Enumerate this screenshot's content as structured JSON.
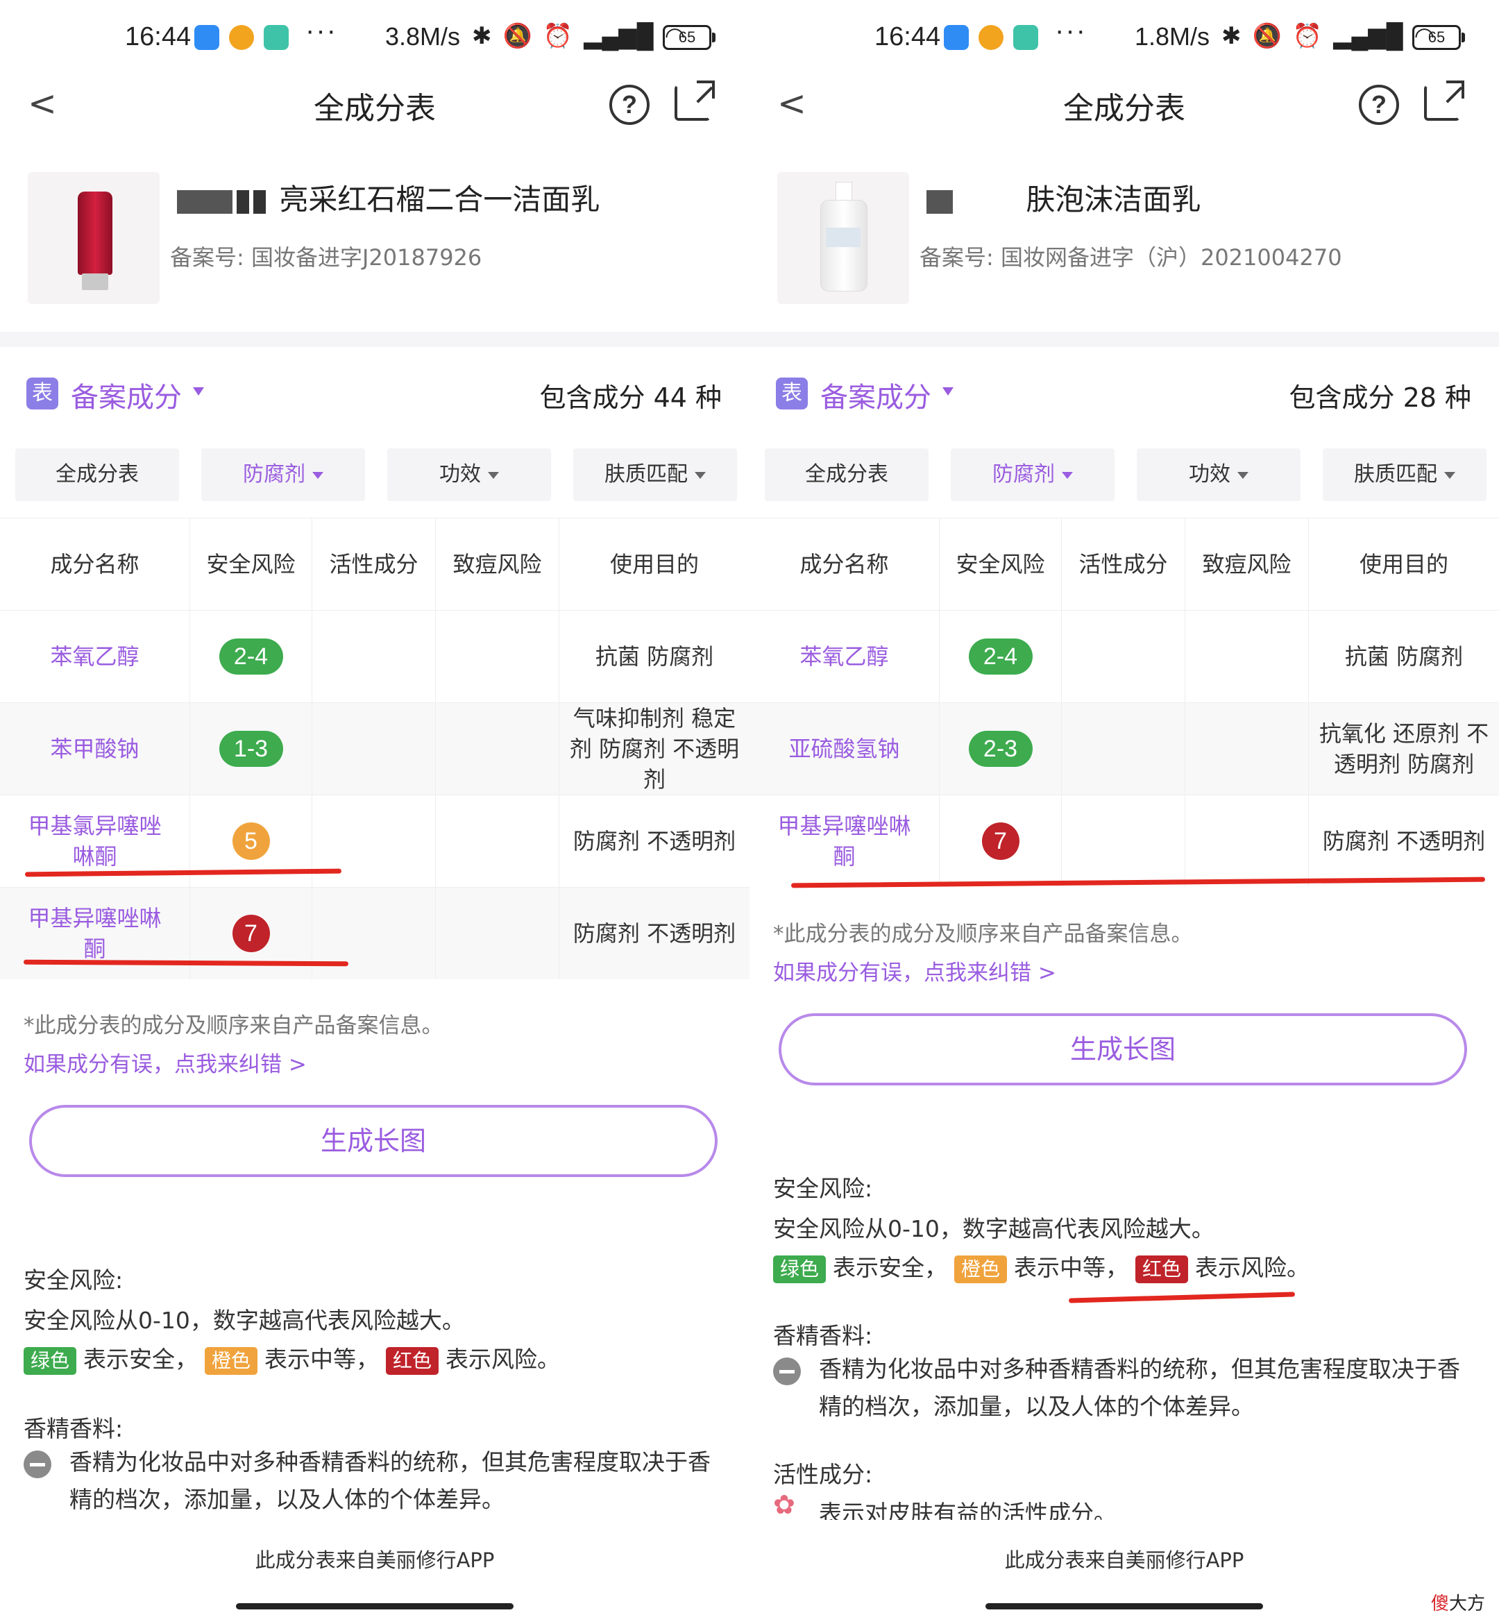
{
  "left": {
    "status": {
      "time": "16:44",
      "dots": "···",
      "speed": "3.8M/s",
      "battery": "65"
    },
    "header": {
      "back": "<",
      "title": "全成分表",
      "help": "?"
    },
    "product": {
      "name": "亮采红石榴二合一洁面乳",
      "reg": "备案号: 国妆备进字J20187926"
    },
    "section": {
      "badge": "表",
      "label": "备案成分",
      "count": "包含成分 44 种"
    },
    "tabs": [
      "全成分表",
      "防腐剂",
      "功效",
      "肤质匹配"
    ],
    "headers": [
      "成分名称",
      "安全风险",
      "活性成分",
      "致痘风险",
      "使用目的"
    ],
    "rows": [
      {
        "name": "苯氧乙醇",
        "risk": "2-4",
        "purpose": "抗菌 防腐剂"
      },
      {
        "name": "苯甲酸钠",
        "risk": "1-3",
        "purpose": "气味抑制剂 稳定剂 防腐剂 不透明剂"
      },
      {
        "name": "甲基氯异噻唑啉酮",
        "risk": "5",
        "purpose": "防腐剂 不透明剂"
      },
      {
        "name": "甲基异噻唑啉酮",
        "risk": "7",
        "purpose": "防腐剂 不透明剂"
      }
    ],
    "note": "*此成分表的成分及顺序来自产品备案信息。",
    "fix": "如果成分有误，点我来纠错 >",
    "button": "生成长图",
    "safety_title": "安全风险:",
    "safety_text": "安全风险从0-10，数字越高代表风险越大。",
    "legend": {
      "green": "绿色",
      "green_text": "表示安全，",
      "orange": "橙色",
      "orange_text": "表示中等，",
      "red": "红色",
      "red_text": "表示风险。"
    },
    "fragrance_title": "香精香料:",
    "fragrance_text": "香精为化妆品中对多种香精香料的统称，但其危害程度取决于香精的档次，添加量，以及人体的个体差异。",
    "footer": "此成分表来自美丽修行APP"
  },
  "right": {
    "status": {
      "time": "16:44",
      "dots": "···",
      "speed": "1.8M/s",
      "battery": "65"
    },
    "header": {
      "back": "<",
      "title": "全成分表",
      "help": "?"
    },
    "product": {
      "name": "肤泡沫洁面乳",
      "reg": "备案号: 国妆网备进字（沪）2021004270"
    },
    "section": {
      "badge": "表",
      "label": "备案成分",
      "count": "包含成分 28 种"
    },
    "tabs": [
      "全成分表",
      "防腐剂",
      "功效",
      "肤质匹配"
    ],
    "headers": [
      "成分名称",
      "安全风险",
      "活性成分",
      "致痘风险",
      "使用目的"
    ],
    "rows": [
      {
        "name": "苯氧乙醇",
        "risk": "2-4",
        "purpose": "抗菌 防腐剂"
      },
      {
        "name": "亚硫酸氢钠",
        "risk": "2-3",
        "purpose": "抗氧化 还原剂 不透明剂 防腐剂"
      },
      {
        "name": "甲基异噻唑啉酮",
        "risk": "7",
        "purpose": "防腐剂 不透明剂"
      }
    ],
    "note": "*此成分表的成分及顺序来自产品备案信息。",
    "fix": "如果成分有误，点我来纠错 >",
    "button": "生成长图",
    "safety_title": "安全风险:",
    "safety_text": "安全风险从0-10，数字越高代表风险越大。",
    "legend": {
      "green": "绿色",
      "green_text": "表示安全，",
      "orange": "橙色",
      "orange_text": "表示中等，",
      "red": "红色",
      "red_text": "表示风险。"
    },
    "fragrance_title": "香精香料:",
    "fragrance_text": "香精为化妆品中对多种香精香料的统称，但其危害程度取决于香精的档次，添加量，以及人体的个体差异。",
    "active_title": "活性成分:",
    "active_text": "表示对皮肤有益的活性成分。",
    "footer": "此成分表来自美丽修行APP"
  },
  "watermark": {
    "red": "傻",
    "black": "大方"
  },
  "colors": {
    "accent": "#9a5ce0",
    "safe": "#3dab4e",
    "medium": "#f0a33c",
    "risk": "#c0232a",
    "annotation": "#e2271f"
  }
}
